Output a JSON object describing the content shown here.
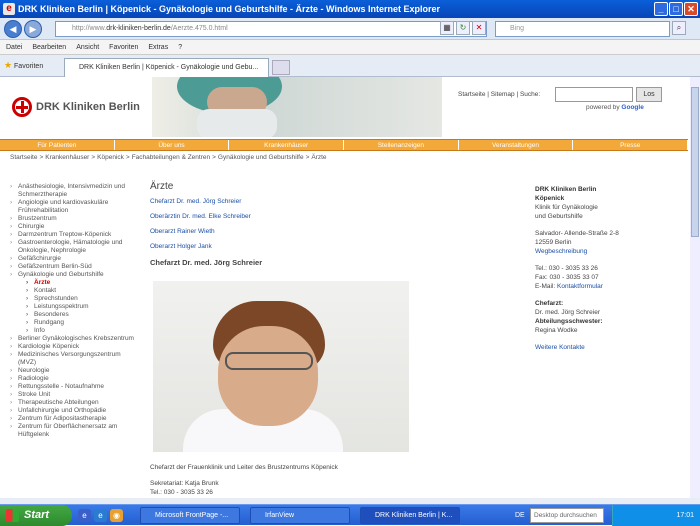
{
  "window": {
    "title": "DRK Kliniken Berlin | Köpenick - Gynäkologie und Geburtshilfe - Ärzte - Windows Internet Explorer"
  },
  "browser": {
    "address_prefix": "http://www.",
    "address_domain": "drk-kliniken-berlin.de",
    "address_path": "/Aerzte.475.0.html",
    "search_placeholder": "Bing",
    "menu": [
      "Datei",
      "Bearbeiten",
      "Ansicht",
      "Favoriten",
      "Extras",
      "?"
    ],
    "favorites_label": "Favoriten",
    "tab_title": "DRK Kliniken Berlin | Köpenick - Gynäkologie und Gebu..."
  },
  "site": {
    "logo": "DRK Kliniken Berlin",
    "top_links": [
      "Startseite",
      "Sitemap",
      "Suche:"
    ],
    "search_button": "Los",
    "powered_by": "powered by",
    "powered_brand": "Google",
    "main_nav": [
      "Für Patienten",
      "Über uns",
      "Krankenhäuser",
      "Stellenanzeigen",
      "Veranstaltungen",
      "Presse"
    ],
    "breadcrumb": [
      "Startseite",
      "Krankenhäuser",
      "Köpenick",
      "Fachabteilungen & Zentren",
      "Gynäkologie und Geburtshilfe",
      "Ärzte"
    ],
    "sidenav": [
      "Anästhesiologie, Intensivmedizin und Schmerztherapie",
      "Angiologie und kardiovaskuläre Frührehabilitation",
      "Brustzentrum",
      "Chirurgie",
      "Darmzentrum Treptow-Köpenick",
      "Gastroenterologie, Hämatologie und Onkologie, Nephrologie",
      "Gefäßchirurgie",
      "Gefäßzentrum Berlin-Süd",
      "Gynäkologie und Geburtshilfe"
    ],
    "sidenav_sub": [
      "Ärzte",
      "Kontakt",
      "Sprechstunden",
      "Leistungsspektrum",
      "Besonderes",
      "Rundgang",
      "Info"
    ],
    "sidenav_after": [
      "Berliner Gynäkologisches Krebszentrum",
      "Kardiologie Köpenick",
      "Medizinisches Versorgungszentrum (MVZ)",
      "Neurologie",
      "Radiologie",
      "Rettungsstelle - Notaufnahme",
      "Stroke Unit",
      "Therapeutische Abteilungen",
      "Unfallchirurgie und Orthopädie",
      "Zentrum für Adipositastherapie",
      "Zentrum für Oberflächenersatz am Hüftgelenk"
    ],
    "heading": "Ärzte",
    "doctors": [
      "Chefarzt Dr. med. Jörg Schreier",
      "Oberärztin Dr. med. Elke Schreiber",
      "Oberarzt Rainer Wieth",
      "Oberarzt Holger Jank"
    ],
    "section_title": "Chefarzt Dr. med. Jörg Schreier",
    "caption": "Chefarzt der Frauenklinik und Leiter des Brustzentrums Köpenick",
    "sekretariat": "Sekretariat: Katja Brunk",
    "sek_tel": "Tel.: 030 - 3035 33 26",
    "contact": {
      "name": "DRK Kliniken Berlin",
      "site": "Köpenick",
      "dept1": "Klinik für Gynäkologie",
      "dept2": "und Geburtshilfe",
      "street": "Salvador- Allende-Straße 2-8",
      "city": "12559 Berlin",
      "route": "Wegbeschreibung",
      "tel": "Tel.: 030 - 3035 33 26",
      "fax": "Fax: 030 - 3035 33 07",
      "email_label": "E-Mail:",
      "email_link": "Kontaktformular",
      "chef_label": "Chefarzt:",
      "chef_name": "Dr. med. Jörg Schreier",
      "nurse_label": "Abteilungsschwester:",
      "nurse_name": "Regina Wodke",
      "more": "Weitere Kontakte"
    }
  },
  "taskbar": {
    "start": "Start",
    "tasks": [
      "Microsoft FrontPage -...",
      "IrfanView",
      "DRK Kliniken Berlin | K..."
    ],
    "lang": "DE",
    "desktop_search": "Desktop durchsuchen",
    "clock": "17:01"
  }
}
